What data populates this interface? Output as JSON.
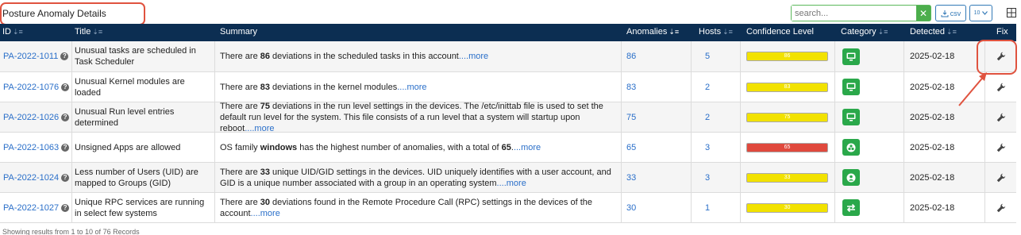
{
  "header": {
    "title": "Posture Anomaly Details",
    "search_placeholder": "search...",
    "csv_label": "csv",
    "page_size": "10"
  },
  "columns": {
    "id": "ID",
    "title": "Title",
    "summary": "Summary",
    "anomalies": "Anomalies",
    "hosts": "Hosts",
    "confidence": "Confidence Level",
    "category": "Category",
    "detected": "Detected",
    "fix": "Fix"
  },
  "colors": {
    "header_bg": "#0c2e52",
    "link": "#2a6fc9",
    "confidence_yellow": "#f2e200",
    "confidence_red": "#e0493d",
    "category_green": "#2aa84a",
    "annotation_red": "#e0533f"
  },
  "rows": [
    {
      "id": "PA-2022-1011",
      "title": "Unusual tasks are scheduled in Task Scheduler",
      "summary_pre": "There are ",
      "summary_bold": "86",
      "summary_post": " deviations in the scheduled tasks in this account",
      "more": "....more",
      "anomalies": "86",
      "hosts": "5",
      "confidence": "86",
      "confidence_color": "yellow",
      "category_icon": "monitor-icon",
      "detected": "2025-02-18"
    },
    {
      "id": "PA-2022-1076",
      "title": "Unusual Kernel modules are loaded",
      "summary_pre": "There are ",
      "summary_bold": "83",
      "summary_post": " deviations in the kernel modules",
      "more": "....more",
      "anomalies": "83",
      "hosts": "2",
      "confidence": "83",
      "confidence_color": "yellow",
      "category_icon": "monitor-icon",
      "detected": "2025-02-18"
    },
    {
      "id": "PA-2022-1026",
      "title": "Unusual Run level entries determined",
      "summary_pre": "There are ",
      "summary_bold": "75",
      "summary_post": " deviations in the run level settings in the devices. The /etc/inittab file is used to set the default run level for the system. This file consists of a run level that a system will startup upon reboot",
      "more": "....more",
      "anomalies": "75",
      "hosts": "2",
      "confidence": "75",
      "confidence_color": "yellow",
      "category_icon": "monitor-icon",
      "detected": "2025-02-18"
    },
    {
      "id": "PA-2022-1063",
      "title": "Unsigned Apps are allowed",
      "summary_pre": "OS family ",
      "summary_bold": "windows",
      "summary_mid": " has the highest number of anomalies, with a total of ",
      "summary_bold2": "65",
      "summary_post": ".",
      "more": "...more",
      "anomalies": "65",
      "hosts": "3",
      "confidence": "65",
      "confidence_color": "red",
      "category_icon": "apps-icon",
      "detected": "2025-02-18"
    },
    {
      "id": "PA-2022-1024",
      "title": "Less number of Users (UID) are mapped to Groups (GID)",
      "summary_pre": "There are ",
      "summary_bold": "33",
      "summary_post": " unique UID/GID settings in the devices. UID uniquely identifies with a user account, and GID is a unique number associated with a group in an operating system",
      "more": "....more",
      "anomalies": "33",
      "hosts": "3",
      "confidence": "33",
      "confidence_color": "yellow",
      "category_icon": "user-icon",
      "detected": "2025-02-18"
    },
    {
      "id": "PA-2022-1027",
      "title": "Unique RPC services are running in select few systems",
      "summary_pre": "There are ",
      "summary_bold": "30",
      "summary_post": " deviations found in the Remote Procedure Call (RPC) settings in the devices of the account",
      "more": "....more",
      "anomalies": "30",
      "hosts": "1",
      "confidence": "30",
      "confidence_color": "yellow",
      "category_icon": "exchange-icon",
      "detected": "2025-02-18"
    }
  ],
  "footer": "Showing results from 1 to 10 of 76 Records"
}
